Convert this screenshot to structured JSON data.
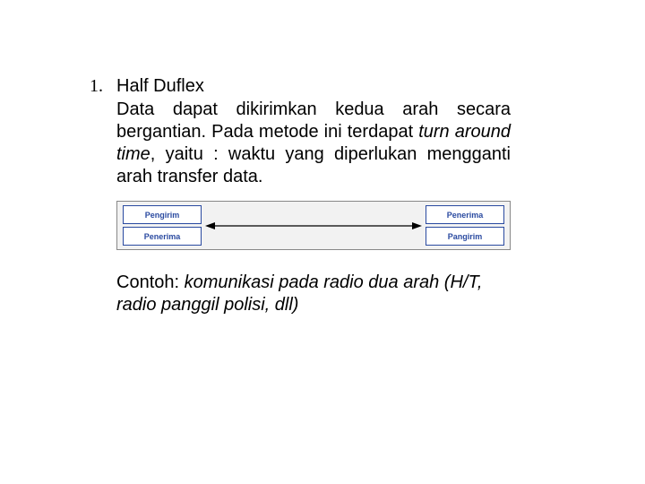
{
  "list": {
    "number": "1.",
    "title": "Half Duflex",
    "paragraph_plain": "Data dapat dikirimkan kedua arah secara bergantian. Pada metode ini terdapat ",
    "paragraph_italic": "turn around time",
    "paragraph_plain2": ", yaitu : waktu yang diperlukan mengganti arah transfer data."
  },
  "diagram": {
    "left": {
      "top": "Pengirim",
      "bottom": "Penerima"
    },
    "right": {
      "top": "Penerima",
      "bottom": "Pangirim"
    }
  },
  "contoh": {
    "label": "Contoh: ",
    "italic": "komunikasi pada radio dua arah (H/T, radio panggil polisi, dll)"
  }
}
